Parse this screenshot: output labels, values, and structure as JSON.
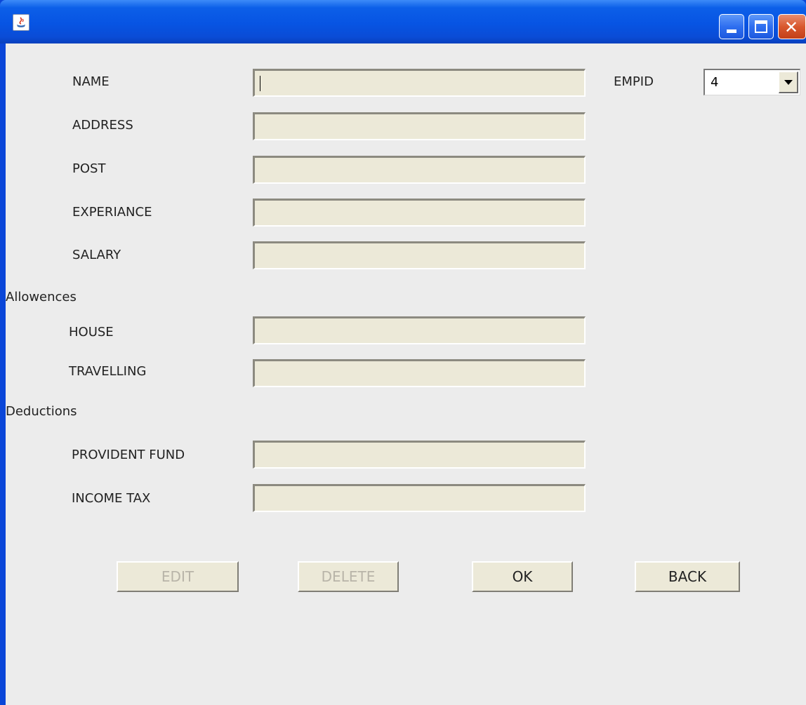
{
  "window": {
    "title": ""
  },
  "titlebar": {
    "icons": [
      "java-icon",
      "minimize-icon",
      "maximize-icon",
      "close-icon"
    ]
  },
  "form": {
    "fields": [
      {
        "label": "NAME",
        "value": ""
      },
      {
        "label": "ADDRESS",
        "value": ""
      },
      {
        "label": "POST",
        "value": ""
      },
      {
        "label": "EXPERIANCE",
        "value": ""
      },
      {
        "label": "SALARY",
        "value": ""
      }
    ],
    "allowances": {
      "heading": "Allowences",
      "fields": [
        {
          "label": "HOUSE",
          "value": ""
        },
        {
          "label": "TRAVELLING",
          "value": ""
        }
      ]
    },
    "deductions": {
      "heading": "Deductions",
      "fields": [
        {
          "label": "PROVIDENT FUND",
          "value": ""
        },
        {
          "label": "INCOME TAX",
          "value": ""
        }
      ]
    },
    "empid": {
      "label": "EMPID",
      "selected": "4"
    }
  },
  "buttons": {
    "edit": {
      "label": "EDIT",
      "enabled": false
    },
    "delete": {
      "label": "DELETE",
      "enabled": false
    },
    "ok": {
      "label": "OK",
      "enabled": true
    },
    "back": {
      "label": "BACK",
      "enabled": true
    }
  },
  "colors": {
    "titlebar": "#0754e3",
    "panel": "#ececec",
    "field": "#ece9d8",
    "close": "#d9582e",
    "disabled_text": "#b8b4a8"
  }
}
